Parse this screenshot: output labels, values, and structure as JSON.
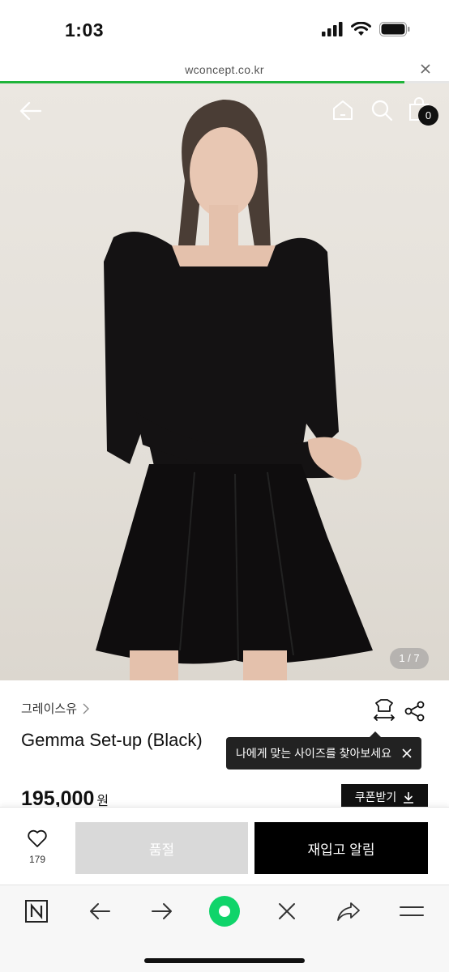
{
  "status_bar": {
    "time": "1:03"
  },
  "url_bar": {
    "url": "wconcept.co.kr",
    "load_progress": 0.9
  },
  "header": {
    "cart_count": "0"
  },
  "gallery": {
    "counter": "1 / 7"
  },
  "product": {
    "brand": "그레이스유",
    "name": "Gemma Set-up (Black)",
    "price": "195,000",
    "currency": "원",
    "size_tooltip": "나에게 맞는 사이즈를 찾아보세요",
    "coupon_label": "쿠폰받기"
  },
  "purchase": {
    "like_count": "179",
    "soldout_label": "품절",
    "restock_label": "재입고 알림"
  },
  "colors": {
    "accent_green": "#1fb43a",
    "sold_out_gray": "#d9d9d9",
    "black": "#000000"
  }
}
